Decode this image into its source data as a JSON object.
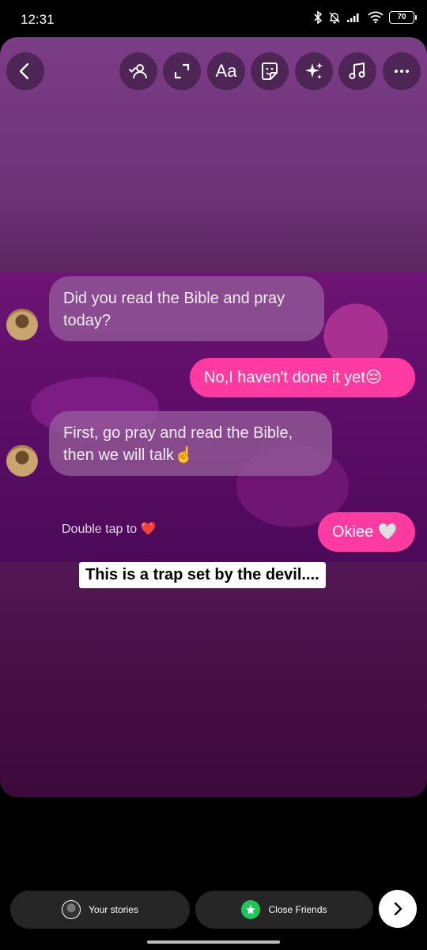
{
  "status_bar": {
    "time": "12:31",
    "battery": "70"
  },
  "toolbar": {
    "buttons": [
      "back-icon",
      "mention-icon",
      "resize-icon",
      "text-icon",
      "sticker-icon",
      "effects-icon",
      "music-icon",
      "more-icon"
    ],
    "text_label": "Aa"
  },
  "chat": {
    "messages": [
      {
        "from": "them",
        "text": "Did you read the Bible and pray today?"
      },
      {
        "from": "me",
        "text": "No,I haven't done it yet😔"
      },
      {
        "from": "them",
        "text": "First, go pray and read the Bible, then we will talk☝️"
      },
      {
        "from": "me",
        "text": "Okiee 🤍"
      }
    ],
    "double_tap": "Double tap to ❤️"
  },
  "caption": "This is a trap set by the devil....",
  "bottom_bar": {
    "your_stories": "Your stories",
    "close_friends": "Close Friends"
  },
  "colors": {
    "accent_pink": "#ff3aa0",
    "close_friends_green": "#1ec65a"
  }
}
